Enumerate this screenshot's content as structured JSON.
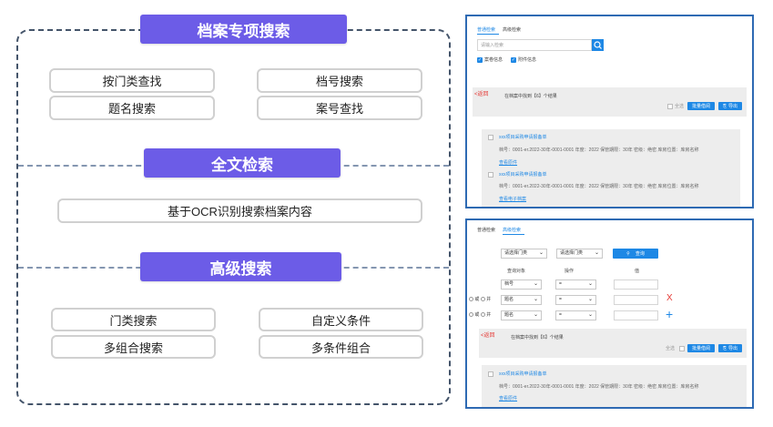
{
  "diagram": {
    "sections": {
      "special": {
        "title": "档案专项搜索",
        "items": [
          "按门类查找",
          "档号搜索",
          "题名搜索",
          "案号查找"
        ]
      },
      "fulltext": {
        "title": "全文检索",
        "items": [
          "基于OCR识别搜索档案内容"
        ]
      },
      "advanced": {
        "title": "高级搜索",
        "items": [
          "门类搜索",
          "自定义条件",
          "多组合搜索",
          "多条件组合"
        ]
      }
    }
  },
  "shot1": {
    "tabs": [
      "普通检索",
      "高级检索"
    ],
    "search_placeholder": "请输入检索",
    "checkbox_labels": [
      "案卷信息",
      "附件信息"
    ],
    "back_label": "<返回",
    "result_text": "在档案中找到【6】个结果",
    "select_all": "全选",
    "btn_batch": "批量借阅",
    "btn_export": "导出",
    "results": [
      {
        "title": "xxx项目采购申请报备单",
        "meta": "档号：0001-er.2022-30年-0001-0001    年度：2022    保管期限：30年    密级：绝密    库房位置：库房名称",
        "link": "查看原件"
      },
      {
        "title": "xxx项目采购申请报备单",
        "meta": "档号：0001-er.2022-30年-0001-0001    年度：2022    保管期限：30年    密级：绝密    库房位置：库房名称",
        "link": "查看电子档案"
      }
    ]
  },
  "shot2": {
    "tabs": [
      "普通检索",
      "高级检索"
    ],
    "selects_top": [
      "请选择门类",
      "请选择门类"
    ],
    "query_btn": "查询",
    "col_headers": [
      "查询对象",
      "操作",
      "值"
    ],
    "rows": [
      {
        "logic": [],
        "field": "档号",
        "op": "="
      },
      {
        "logic": [
          "或",
          "并"
        ],
        "field": "题名",
        "op": "="
      },
      {
        "logic": [
          "或",
          "并"
        ],
        "field": "题名",
        "op": "="
      }
    ],
    "remove_symbol": "X",
    "add_symbol": "+",
    "back_label": "<返回",
    "result_text": "在档案中找到【6】个结果",
    "select_all": "全选",
    "btn_batch": "批量借阅",
    "btn_export": "导出",
    "results": [
      {
        "title": "xxx项目采购申请报备单",
        "meta": "档号：0001-er.2022-30年-0001-0001    年度：2022    保管期限：30年    密级：绝密    库房位置：库房名称",
        "link": "查看原件"
      }
    ]
  }
}
